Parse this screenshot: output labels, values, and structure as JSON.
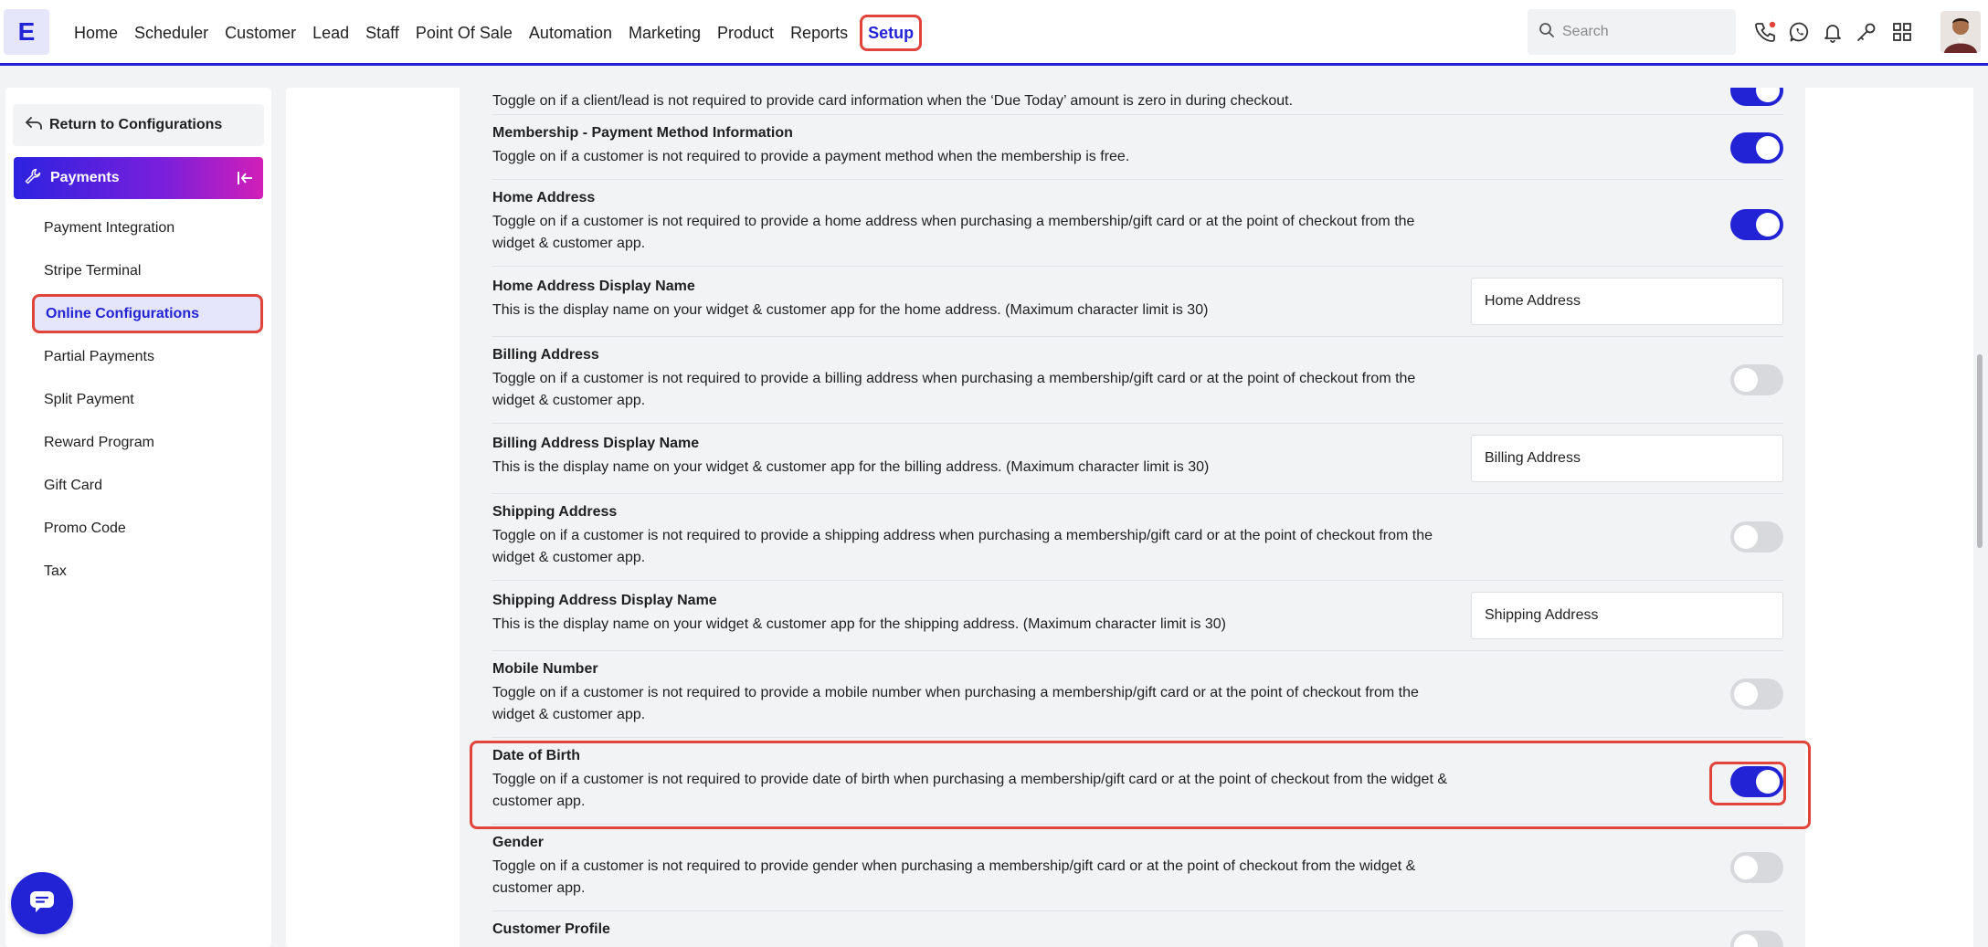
{
  "app": {
    "logo_letter": "E"
  },
  "nav": {
    "items": [
      "Home",
      "Scheduler",
      "Customer",
      "Lead",
      "Staff",
      "Point Of Sale",
      "Automation",
      "Marketing",
      "Product",
      "Reports"
    ],
    "active": "Setup"
  },
  "search": {
    "placeholder": "Search"
  },
  "top_icons": [
    "phone-icon",
    "whatsapp-icon",
    "bell-icon",
    "key-icon",
    "grid-icon"
  ],
  "sidebar": {
    "return_label": "Return to Configurations",
    "section_label": "Payments",
    "items": [
      {
        "label": "Payment Integration",
        "active": false
      },
      {
        "label": "Stripe Terminal",
        "active": false
      },
      {
        "label": "Online Configurations",
        "active": true
      },
      {
        "label": "Partial Payments",
        "active": false
      },
      {
        "label": "Split Payment",
        "active": false
      },
      {
        "label": "Reward Program",
        "active": false
      },
      {
        "label": "Gift Card",
        "active": false
      },
      {
        "label": "Promo Code",
        "active": false
      },
      {
        "label": "Tax",
        "active": false
      }
    ]
  },
  "settings": [
    {
      "title": "",
      "desc": "Toggle on if a client/lead is not required to provide card information when the ‘Due Today’ amount is zero in during checkout.",
      "control": "toggle",
      "on": true
    },
    {
      "title": "Membership - Payment Method Information",
      "desc": "Toggle on if a customer is not required to provide a payment method when the membership is free.",
      "control": "toggle",
      "on": true
    },
    {
      "title": "Home Address",
      "desc": "Toggle on if a customer is not required to provide a home address when purchasing a membership/gift card or at the point of checkout from the widget & customer app.",
      "control": "toggle",
      "on": true
    },
    {
      "title": "Home Address Display Name",
      "desc": "This is the display name on your widget & customer app for the home address. (Maximum character limit is 30)",
      "control": "input",
      "value": "Home Address"
    },
    {
      "title": "Billing Address",
      "desc": "Toggle on if a customer is not required to provide a billing address when purchasing a membership/gift card or at the point of checkout from the widget & customer app.",
      "control": "toggle",
      "on": false
    },
    {
      "title": "Billing Address Display Name",
      "desc": "This is the display name on your widget & customer app for the billing address. (Maximum character limit is 30)",
      "control": "input",
      "value": "Billing Address"
    },
    {
      "title": "Shipping Address",
      "desc": "Toggle on if a customer is not required to provide a shipping address when purchasing a membership/gift card or at the point of checkout from the widget & customer app.",
      "control": "toggle",
      "on": false
    },
    {
      "title": "Shipping Address Display Name",
      "desc": "This is the display name on your widget & customer app for the shipping address. (Maximum character limit is 30)",
      "control": "input",
      "value": "Shipping Address"
    },
    {
      "title": "Mobile Number",
      "desc": "Toggle on if a customer is not required to provide a mobile number when purchasing a membership/gift card or at the point of checkout from the widget & customer app.",
      "control": "toggle",
      "on": false
    },
    {
      "title": "Date of Birth",
      "desc": "Toggle on if a customer is not required to provide date of birth when purchasing a membership/gift card or at the point of checkout from the widget & customer app.",
      "control": "toggle",
      "on": true
    },
    {
      "title": "Gender",
      "desc": "Toggle on if a customer is not required to provide gender when purchasing a membership/gift card or at the point of checkout from the widget & customer app.",
      "control": "toggle",
      "on": false
    },
    {
      "title": "Customer Profile",
      "desc": "",
      "control": "toggle",
      "on": false
    }
  ],
  "colors": {
    "accent": "#2323d6",
    "highlight": "#e0443a",
    "toggle_off": "#d8d9dc"
  }
}
